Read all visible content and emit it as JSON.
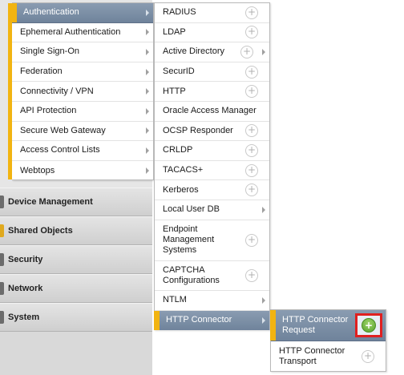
{
  "left_nav": {
    "sections": [
      {
        "label": "Device Management",
        "icon": "device-icon"
      },
      {
        "label": "Shared Objects",
        "icon": "shared-objects-icon"
      },
      {
        "label": "Security",
        "icon": "security-icon"
      },
      {
        "label": "Network",
        "icon": "network-icon"
      },
      {
        "label": "System",
        "icon": "system-icon"
      }
    ]
  },
  "menu_level1": {
    "items": [
      {
        "label": "Authentication",
        "active": true
      },
      {
        "label": "Ephemeral Authentication"
      },
      {
        "label": "Single Sign-On"
      },
      {
        "label": "Federation"
      },
      {
        "label": "Connectivity / VPN"
      },
      {
        "label": "API Protection"
      },
      {
        "label": "Secure Web Gateway"
      },
      {
        "label": "Access Control Lists"
      },
      {
        "label": "Webtops"
      }
    ]
  },
  "menu_level2": {
    "items": [
      {
        "label": "RADIUS"
      },
      {
        "label": "LDAP"
      },
      {
        "label": "Active Directory"
      },
      {
        "label": "SecurID"
      },
      {
        "label": "HTTP"
      },
      {
        "label": "Oracle Access Manager"
      },
      {
        "label": "OCSP Responder"
      },
      {
        "label": "CRLDP"
      },
      {
        "label": "TACACS+"
      },
      {
        "label": "Kerberos"
      },
      {
        "label": "Local User DB"
      },
      {
        "label": "Endpoint Management Systems"
      },
      {
        "label": "CAPTCHA Configurations"
      },
      {
        "label": "NTLM"
      },
      {
        "label": "HTTP Connector",
        "active": true
      }
    ]
  },
  "menu_level3": {
    "items": [
      {
        "label": "HTTP Connector Request",
        "active": true
      },
      {
        "label": "HTTP Connector Transport"
      }
    ]
  },
  "icons": {
    "add": "+"
  },
  "colors": {
    "active_bg": "#7a8ea6",
    "accent": "#f2b411",
    "highlight": "#e02020",
    "add_green": "#55a22b"
  }
}
